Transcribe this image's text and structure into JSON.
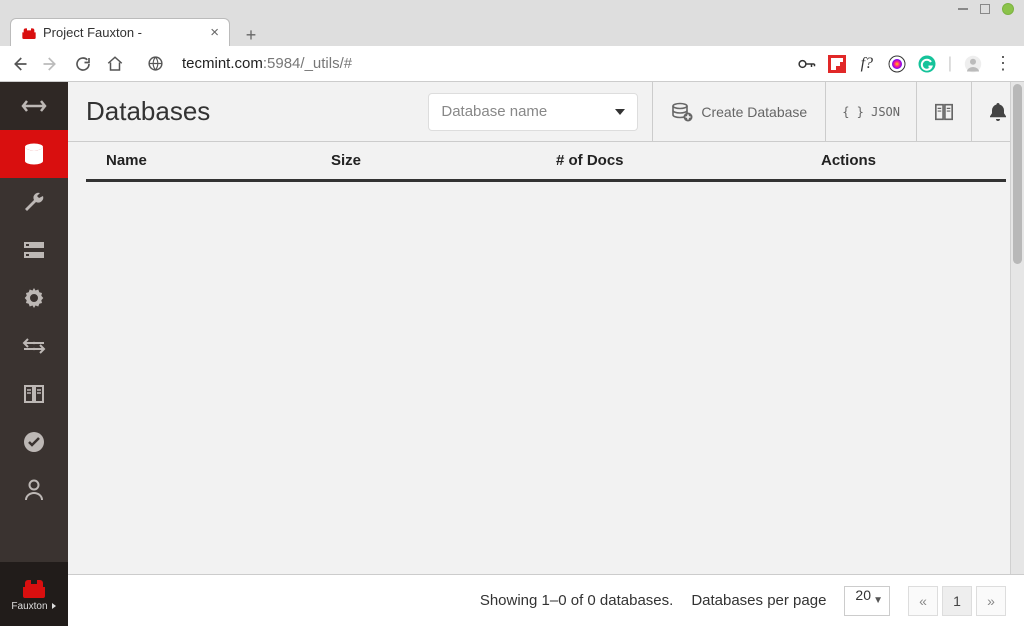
{
  "browser": {
    "tab_title": "Project Fauxton -",
    "url_host": "tecmint.com",
    "url_rest": ":5984/_utils/#"
  },
  "header": {
    "title": "Databases",
    "search_placeholder": "Database name",
    "create_label": "Create Database",
    "json_label": "{ } JSON"
  },
  "table": {
    "columns": {
      "name": "Name",
      "size": "Size",
      "docs": "# of Docs",
      "actions": "Actions"
    }
  },
  "footer": {
    "showing": "Showing 1–0 of 0 databases.",
    "per_page_label": "Databases per page",
    "per_page_value": "20",
    "page_current": "1",
    "page_prev": "«",
    "page_next": "»"
  },
  "brand": {
    "label": "Fauxton"
  }
}
